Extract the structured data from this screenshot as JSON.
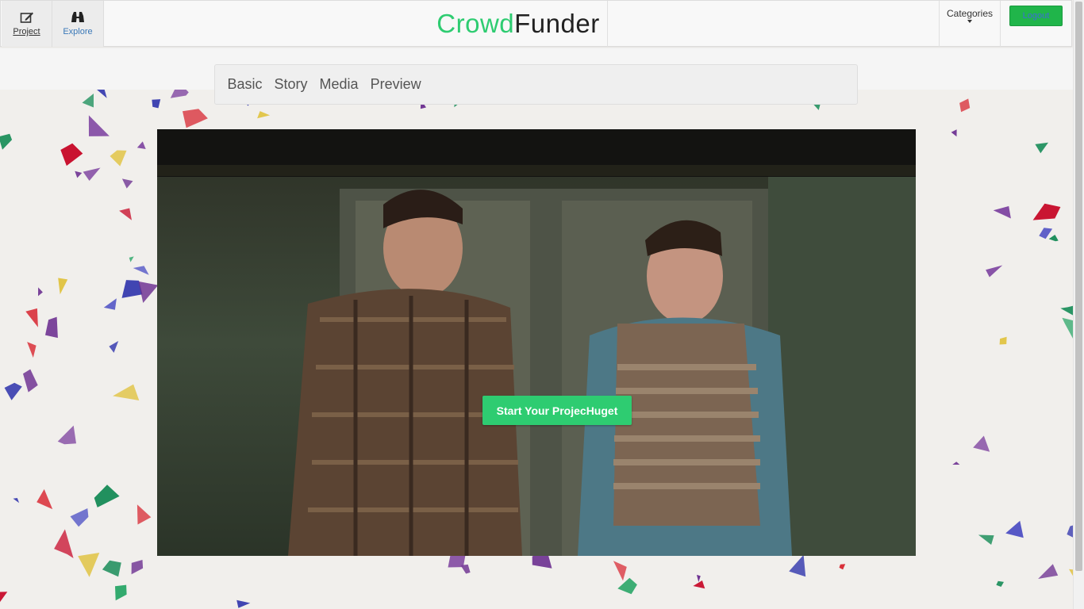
{
  "navbar": {
    "project_label": "Project",
    "explore_label": "Explore",
    "brand_part1": "Crowd",
    "brand_part2": "Funder",
    "categories_label": "Categories",
    "logout_label": "Logout"
  },
  "tabs": [
    {
      "label": "Basic"
    },
    {
      "label": "Story"
    },
    {
      "label": "Media"
    },
    {
      "label": "Preview"
    }
  ],
  "hero": {
    "cta_label": "Start Your ProjecHuget"
  },
  "colors": {
    "brand_green": "#2ecc71",
    "logout_green": "#20b54a",
    "explore_blue": "#3a78b8"
  },
  "icons": {
    "project": "edit-icon",
    "explore": "binoculars-icon",
    "categories": "caret-down-icon"
  }
}
